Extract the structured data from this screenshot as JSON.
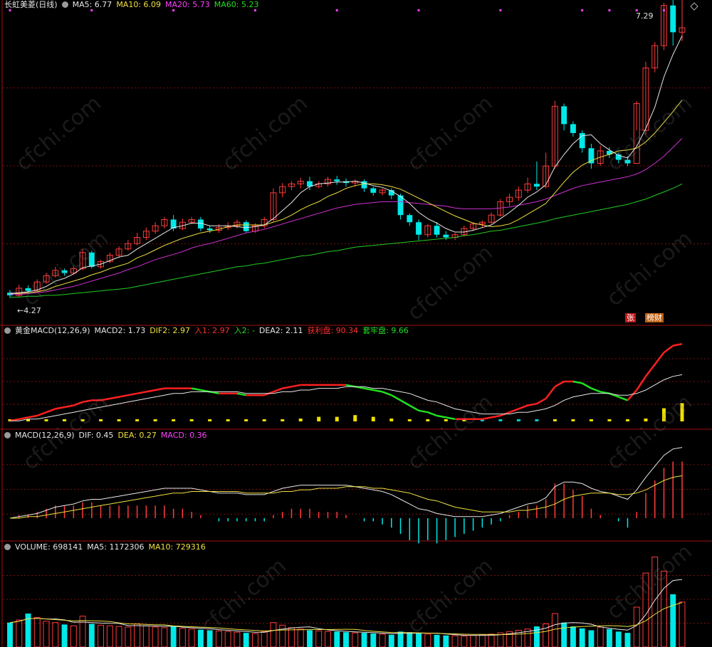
{
  "main_panel": {
    "title": "长虹美菱(日线)",
    "ma5": "MA5: 6.77",
    "ma10": "MA10: 6.09",
    "ma20": "MA20: 5.73",
    "ma60": "MA60: 5.23",
    "high_label": "7.29",
    "low_label": "4.27",
    "badge_zhang": "张",
    "badge_bangcai": "榜财"
  },
  "gold_macd_panel": {
    "title": "黄金MACD(12,26,9)",
    "macd2": "MACD2: 1.73",
    "dif2": "DIF2: 2.97",
    "entry1": "入1: 2.97",
    "entry2": "入2: -",
    "dea2": "DEA2: 2.11",
    "profit": "获利盘: 90.34",
    "trapped": "套牢盘: 9.66"
  },
  "macd_panel": {
    "title": "MACD(12,26,9)",
    "dif": "DIF: 0.45",
    "dea": "DEA: 0.27",
    "macd": "MACD: 0.36"
  },
  "volume_panel": {
    "title": "VOLUME: 698141",
    "ma5": "MA5: 1172306",
    "ma10": "MA10: 729316"
  },
  "watermark": "cfchi.com",
  "colors": {
    "up": "#ff3b3b",
    "down": "#00e8e8",
    "ma5": "#e8e8e8",
    "ma10": "#f0e040",
    "ma20": "#d030d0",
    "ma60": "#22cc22",
    "grid": "#7a1010"
  },
  "chart_data": {
    "type": "candlestick",
    "candles": [
      [
        4.33,
        4.3,
        4.36,
        4.27
      ],
      [
        4.3,
        4.38,
        4.42,
        4.28
      ],
      [
        4.38,
        4.35,
        4.41,
        4.33
      ],
      [
        4.35,
        4.45,
        4.48,
        4.34
      ],
      [
        4.45,
        4.52,
        4.55,
        4.43
      ],
      [
        4.52,
        4.58,
        4.62,
        4.5
      ],
      [
        4.58,
        4.55,
        4.6,
        4.52
      ],
      [
        4.55,
        4.6,
        4.63,
        4.54
      ],
      [
        4.6,
        4.78,
        4.82,
        4.58
      ],
      [
        4.78,
        4.62,
        4.8,
        4.6
      ],
      [
        4.62,
        4.68,
        4.7,
        4.6
      ],
      [
        4.68,
        4.75,
        4.78,
        4.66
      ],
      [
        4.75,
        4.82,
        4.85,
        4.72
      ],
      [
        4.82,
        4.88,
        4.92,
        4.8
      ],
      [
        4.88,
        4.95,
        5.0,
        4.86
      ],
      [
        4.95,
        5.02,
        5.06,
        4.92
      ],
      [
        5.02,
        5.08,
        5.12,
        4.99
      ],
      [
        5.08,
        5.15,
        5.18,
        5.05
      ],
      [
        5.15,
        5.05,
        5.2,
        5.02
      ],
      [
        5.05,
        5.12,
        5.16,
        5.03
      ],
      [
        5.12,
        5.15,
        5.18,
        5.1
      ],
      [
        5.15,
        5.05,
        5.18,
        5.02
      ],
      [
        5.05,
        5.03,
        5.08,
        5.0
      ],
      [
        5.03,
        5.06,
        5.1,
        5.0
      ],
      [
        5.06,
        5.08,
        5.12,
        5.03
      ],
      [
        5.08,
        5.12,
        5.15,
        5.05
      ],
      [
        5.12,
        5.02,
        5.14,
        5.0
      ],
      [
        5.02,
        5.08,
        5.11,
        5.0
      ],
      [
        5.08,
        5.15,
        5.18,
        5.05
      ],
      [
        5.15,
        5.45,
        5.5,
        5.12
      ],
      [
        5.45,
        5.52,
        5.56,
        5.4
      ],
      [
        5.52,
        5.55,
        5.58,
        5.48
      ],
      [
        5.55,
        5.58,
        5.62,
        5.5
      ],
      [
        5.58,
        5.52,
        5.63,
        5.48
      ],
      [
        5.52,
        5.55,
        5.58,
        5.5
      ],
      [
        5.55,
        5.6,
        5.63,
        5.52
      ],
      [
        5.6,
        5.58,
        5.64,
        5.54
      ],
      [
        5.58,
        5.56,
        5.61,
        5.52
      ],
      [
        5.56,
        5.58,
        5.6,
        5.52
      ],
      [
        5.58,
        5.5,
        5.6,
        5.46
      ],
      [
        5.5,
        5.45,
        5.52,
        5.42
      ],
      [
        5.45,
        5.48,
        5.5,
        5.42
      ],
      [
        5.48,
        5.42,
        5.5,
        5.38
      ],
      [
        5.42,
        5.2,
        5.44,
        5.15
      ],
      [
        5.2,
        5.12,
        5.22,
        5.08
      ],
      [
        5.12,
        4.98,
        5.15,
        4.92
      ],
      [
        4.98,
        5.08,
        5.1,
        4.95
      ],
      [
        5.08,
        4.98,
        5.12,
        4.95
      ],
      [
        4.98,
        4.95,
        5.02,
        4.92
      ],
      [
        4.95,
        4.98,
        5.0,
        4.92
      ],
      [
        4.98,
        5.05,
        5.08,
        4.96
      ],
      [
        5.05,
        5.1,
        5.12,
        5.02
      ],
      [
        5.1,
        5.12,
        5.14,
        5.06
      ],
      [
        5.12,
        5.2,
        5.23,
        5.1
      ],
      [
        5.2,
        5.35,
        5.38,
        5.18
      ],
      [
        5.35,
        5.4,
        5.44,
        5.3
      ],
      [
        5.4,
        5.48,
        5.52,
        5.36
      ],
      [
        5.48,
        5.55,
        5.62,
        5.45
      ],
      [
        5.55,
        5.52,
        5.8,
        5.48
      ],
      [
        5.52,
        5.75,
        5.9,
        5.5
      ],
      [
        5.75,
        6.42,
        6.48,
        5.72
      ],
      [
        6.42,
        6.22,
        6.45,
        6.15
      ],
      [
        6.22,
        6.12,
        6.25,
        6.08
      ],
      [
        6.12,
        5.95,
        6.15,
        5.9
      ],
      [
        5.95,
        5.78,
        6.0,
        5.72
      ],
      [
        5.78,
        5.92,
        5.98,
        5.75
      ],
      [
        5.92,
        5.88,
        5.96,
        5.84
      ],
      [
        5.88,
        5.82,
        5.9,
        5.78
      ],
      [
        5.82,
        5.78,
        5.86,
        5.75
      ],
      [
        5.78,
        6.45,
        6.48,
        6.15
      ],
      [
        6.15,
        6.85,
        6.92,
        6.1
      ],
      [
        6.85,
        7.1,
        7.14,
        6.8
      ],
      [
        7.1,
        7.55,
        7.58,
        7.05
      ],
      [
        7.55,
        7.25,
        7.62,
        7.1
      ],
      [
        7.25,
        7.3,
        7.62,
        7.15
      ]
    ],
    "ma5": [
      4.32,
      4.33,
      4.34,
      4.36,
      4.4,
      4.46,
      4.49,
      4.54,
      4.61,
      4.63,
      4.65,
      4.69,
      4.73,
      4.75,
      4.82,
      4.88,
      4.94,
      5.0,
      5.06,
      5.08,
      5.11,
      5.11,
      5.08,
      5.08,
      5.08,
      5.07,
      5.06,
      5.07,
      5.09,
      5.16,
      5.25,
      5.34,
      5.45,
      5.52,
      5.55,
      5.56,
      5.57,
      5.57,
      5.58,
      5.56,
      5.53,
      5.51,
      5.47,
      5.41,
      5.33,
      5.23,
      5.16,
      5.11,
      5.05,
      5.01,
      5.01,
      5.03,
      5.06,
      5.09,
      5.16,
      5.23,
      5.31,
      5.4,
      5.46,
      5.54,
      5.74,
      5.88,
      6.0,
      6.09,
      6.1,
      6.0,
      5.93,
      5.87,
      5.84,
      5.97,
      6.17,
      6.41,
      6.75,
      7.0,
      7.21
    ],
    "ma10": [
      4.32,
      4.32,
      4.33,
      4.34,
      4.36,
      4.4,
      4.43,
      4.46,
      4.49,
      4.53,
      4.56,
      4.6,
      4.63,
      4.66,
      4.72,
      4.76,
      4.81,
      4.86,
      4.9,
      4.94,
      4.97,
      5.0,
      5.02,
      5.04,
      5.07,
      5.09,
      5.09,
      5.09,
      5.09,
      5.12,
      5.15,
      5.2,
      5.26,
      5.31,
      5.35,
      5.41,
      5.45,
      5.5,
      5.53,
      5.55,
      5.55,
      5.54,
      5.52,
      5.49,
      5.44,
      5.39,
      5.34,
      5.29,
      5.24,
      5.19,
      5.15,
      5.11,
      5.09,
      5.07,
      5.08,
      5.1,
      5.15,
      5.21,
      5.27,
      5.33,
      5.45,
      5.57,
      5.68,
      5.76,
      5.81,
      5.85,
      5.88,
      5.92,
      5.93,
      5.95,
      6.02,
      6.12,
      6.24,
      6.36,
      6.49
    ],
    "ma20": [
      4.31,
      4.31,
      4.32,
      4.33,
      4.34,
      4.36,
      4.38,
      4.4,
      4.43,
      4.46,
      4.49,
      4.52,
      4.55,
      4.59,
      4.62,
      4.66,
      4.7,
      4.73,
      4.76,
      4.79,
      4.83,
      4.86,
      4.88,
      4.91,
      4.94,
      4.97,
      5.0,
      5.02,
      5.04,
      5.07,
      5.1,
      5.13,
      5.16,
      5.19,
      5.22,
      5.25,
      5.28,
      5.3,
      5.32,
      5.33,
      5.34,
      5.35,
      5.35,
      5.35,
      5.34,
      5.33,
      5.32,
      5.31,
      5.3,
      5.28,
      5.27,
      5.27,
      5.27,
      5.27,
      5.28,
      5.29,
      5.31,
      5.33,
      5.35,
      5.38,
      5.42,
      5.46,
      5.5,
      5.53,
      5.55,
      5.57,
      5.59,
      5.61,
      5.63,
      5.66,
      5.71,
      5.78,
      5.86,
      5.96,
      6.06
    ],
    "ma60": [
      4.28,
      4.28,
      4.29,
      4.29,
      4.3,
      4.3,
      4.31,
      4.32,
      4.33,
      4.34,
      4.35,
      4.36,
      4.37,
      4.38,
      4.4,
      4.42,
      4.44,
      4.46,
      4.48,
      4.5,
      4.52,
      4.54,
      4.56,
      4.58,
      4.6,
      4.62,
      4.63,
      4.65,
      4.66,
      4.68,
      4.7,
      4.72,
      4.74,
      4.75,
      4.77,
      4.79,
      4.8,
      4.82,
      4.84,
      4.85,
      4.86,
      4.87,
      4.88,
      4.89,
      4.9,
      4.91,
      4.92,
      4.93,
      4.94,
      4.95,
      4.97,
      4.98,
      5.0,
      5.02,
      5.03,
      5.05,
      5.07,
      5.09,
      5.11,
      5.13,
      5.16,
      5.18,
      5.2,
      5.22,
      5.24,
      5.26,
      5.28,
      5.3,
      5.32,
      5.35,
      5.38,
      5.42,
      5.46,
      5.5,
      5.55
    ],
    "price_range": [
      4.1,
      7.5
    ],
    "macd_dif": [
      0.0,
      0.01,
      0.02,
      0.03,
      0.05,
      0.07,
      0.08,
      0.09,
      0.11,
      0.12,
      0.12,
      0.13,
      0.14,
      0.15,
      0.16,
      0.17,
      0.18,
      0.19,
      0.19,
      0.19,
      0.19,
      0.18,
      0.17,
      0.16,
      0.16,
      0.16,
      0.15,
      0.15,
      0.15,
      0.17,
      0.19,
      0.2,
      0.21,
      0.21,
      0.21,
      0.21,
      0.21,
      0.21,
      0.2,
      0.19,
      0.18,
      0.17,
      0.15,
      0.12,
      0.09,
      0.06,
      0.05,
      0.03,
      0.02,
      0.01,
      0.01,
      0.01,
      0.01,
      0.02,
      0.03,
      0.05,
      0.07,
      0.09,
      0.1,
      0.13,
      0.2,
      0.23,
      0.23,
      0.22,
      0.19,
      0.17,
      0.16,
      0.14,
      0.12,
      0.18,
      0.26,
      0.33,
      0.4,
      0.44,
      0.45
    ],
    "macd_dea": [
      0.0,
      0.0,
      0.01,
      0.01,
      0.02,
      0.03,
      0.04,
      0.05,
      0.06,
      0.07,
      0.08,
      0.09,
      0.1,
      0.11,
      0.12,
      0.13,
      0.14,
      0.15,
      0.16,
      0.16,
      0.17,
      0.17,
      0.17,
      0.17,
      0.17,
      0.17,
      0.16,
      0.16,
      0.16,
      0.16,
      0.17,
      0.17,
      0.18,
      0.18,
      0.19,
      0.19,
      0.19,
      0.2,
      0.2,
      0.2,
      0.19,
      0.19,
      0.18,
      0.17,
      0.16,
      0.14,
      0.12,
      0.11,
      0.09,
      0.07,
      0.06,
      0.05,
      0.04,
      0.04,
      0.04,
      0.04,
      0.05,
      0.05,
      0.06,
      0.07,
      0.09,
      0.12,
      0.14,
      0.15,
      0.16,
      0.16,
      0.16,
      0.15,
      0.15,
      0.16,
      0.18,
      0.21,
      0.24,
      0.26,
      0.27
    ],
    "volume": [
      380,
      420,
      520,
      460,
      400,
      380,
      350,
      330,
      480,
      360,
      340,
      330,
      320,
      310,
      360,
      330,
      310,
      300,
      320,
      290,
      280,
      270,
      260,
      250,
      240,
      230,
      220,
      210,
      240,
      380,
      340,
      300,
      280,
      260,
      250,
      240,
      240,
      230,
      220,
      220,
      210,
      200,
      190,
      240,
      230,
      220,
      200,
      190,
      180,
      175,
      170,
      180,
      190,
      200,
      220,
      240,
      260,
      280,
      320,
      360,
      520,
      380,
      320,
      290,
      260,
      310,
      280,
      240,
      220,
      620,
      1150,
      1400,
      1180,
      820,
      700
    ],
    "volume_range": [
      0,
      1450
    ]
  }
}
